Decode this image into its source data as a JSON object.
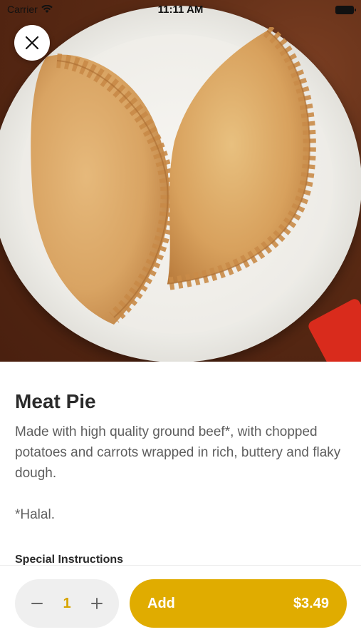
{
  "status_bar": {
    "carrier": "Carrier",
    "time": "11:11 AM"
  },
  "item": {
    "title": "Meat Pie",
    "description": "Made with high quality ground beef*, with chopped potatoes and carrots wrapped in rich, buttery and flaky dough.\n\n*Halal.",
    "special_instructions_label": "Special Instructions"
  },
  "cart": {
    "quantity": "1",
    "add_label": "Add",
    "price": "$3.49"
  },
  "colors": {
    "accent": "#e0ac00",
    "quantity": "#d7a400"
  },
  "icons": [
    "wifi-icon",
    "battery-icon",
    "close-icon",
    "minus-icon",
    "plus-icon"
  ]
}
